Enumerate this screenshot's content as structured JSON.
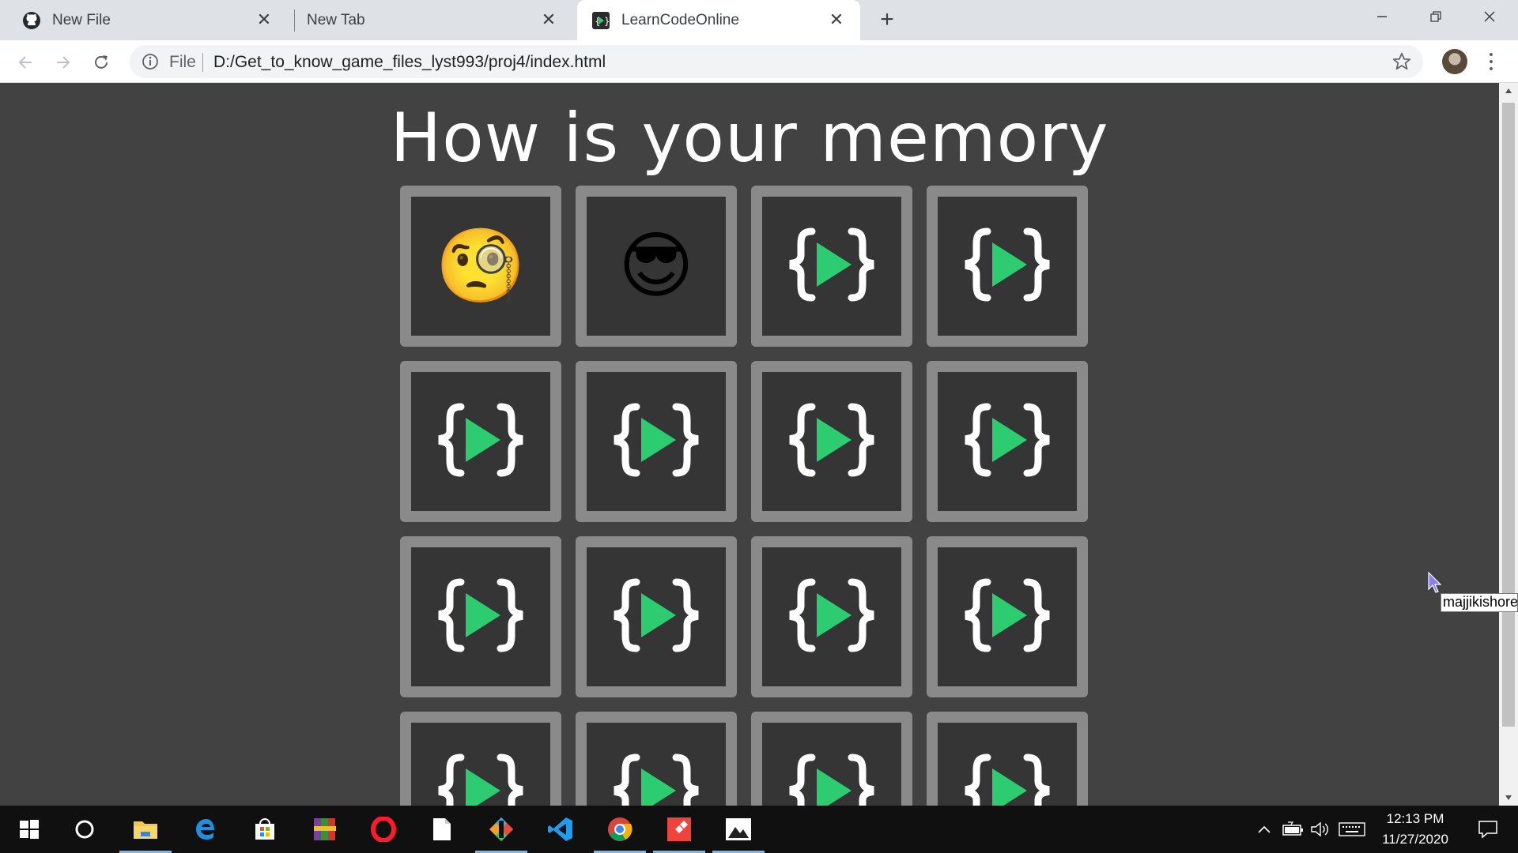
{
  "browser": {
    "tabs": [
      {
        "title": "New File",
        "favicon": "github-icon",
        "active": false
      },
      {
        "title": "New Tab",
        "favicon": "",
        "active": false
      },
      {
        "title": "LearnCodeOnline",
        "favicon": "learncodeonline-icon",
        "active": true
      }
    ],
    "omnibox": {
      "scheme_label": "File",
      "url": "D:/Get_to_know_game_files_lyst993/proj4/index.html"
    }
  },
  "page": {
    "heading": "How is your memory",
    "cards": [
      {
        "state": "revealed",
        "content": "🧐",
        "icon": "face-with-monocle-emoji"
      },
      {
        "state": "revealed",
        "content": "😎",
        "icon": "smiling-face-with-sunglasses-emoji"
      },
      {
        "state": "hidden",
        "icon": "learncodeonline-logo-icon"
      },
      {
        "state": "hidden",
        "icon": "learncodeonline-logo-icon"
      },
      {
        "state": "hidden",
        "icon": "learncodeonline-logo-icon"
      },
      {
        "state": "hidden",
        "icon": "learncodeonline-logo-icon"
      },
      {
        "state": "hidden",
        "icon": "learncodeonline-logo-icon"
      },
      {
        "state": "hidden",
        "icon": "learncodeonline-logo-icon"
      },
      {
        "state": "hidden",
        "icon": "learncodeonline-logo-icon"
      },
      {
        "state": "hidden",
        "icon": "learncodeonline-logo-icon"
      },
      {
        "state": "hidden",
        "icon": "learncodeonline-logo-icon"
      },
      {
        "state": "hidden",
        "icon": "learncodeonline-logo-icon"
      },
      {
        "state": "hidden",
        "icon": "learncodeonline-logo-icon"
      },
      {
        "state": "hidden",
        "icon": "learncodeonline-logo-icon"
      },
      {
        "state": "hidden",
        "icon": "learncodeonline-logo-icon"
      },
      {
        "state": "hidden",
        "icon": "learncodeonline-logo-icon"
      }
    ],
    "tooltip": "majjikishore"
  },
  "taskbar": {
    "apps": [
      "start-icon",
      "cortana-icon",
      "file-explorer-icon",
      "edge-icon",
      "store-icon",
      "winrar-icon",
      "opera-icon",
      "notepad-icon",
      "git-icon",
      "vscode-icon",
      "chrome-icon",
      "anydesk-icon",
      "photos-icon"
    ],
    "time": "12:13 PM",
    "date": "11/27/2020"
  },
  "colors": {
    "page_bg": "#424242",
    "card_border": "#8a8a8a",
    "card_inner": "#353535",
    "logo_green": "#2ecc71"
  }
}
